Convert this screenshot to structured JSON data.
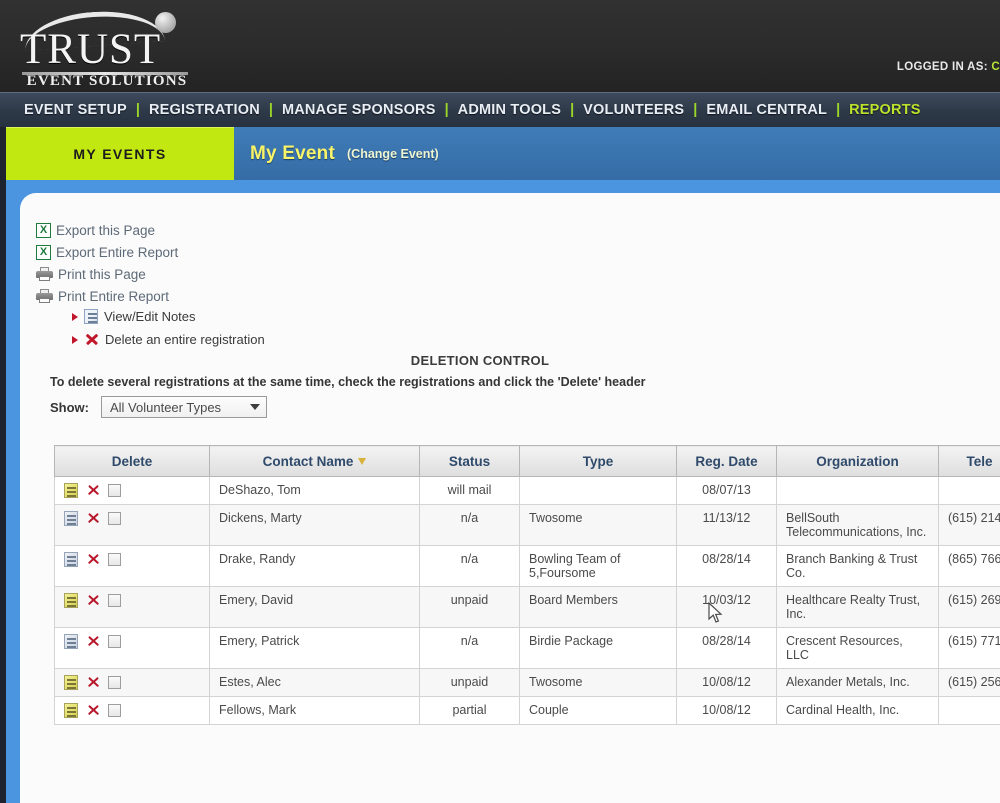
{
  "brand": {
    "name": "TRUST",
    "tagline": "EVENT SOLUTIONS"
  },
  "header": {
    "logged_in_label": "LOGGED IN AS:",
    "logged_in_user": "C"
  },
  "nav": {
    "items": [
      {
        "label": "EVENT SETUP",
        "active": false
      },
      {
        "label": "REGISTRATION",
        "active": false
      },
      {
        "label": "MANAGE SPONSORS",
        "active": false
      },
      {
        "label": "ADMIN TOOLS",
        "active": false
      },
      {
        "label": "VOLUNTEERS",
        "active": false
      },
      {
        "label": "EMAIL CENTRAL",
        "active": false
      },
      {
        "label": "REPORTS",
        "active": true
      }
    ],
    "separator": "|"
  },
  "tabs": {
    "my_events": "MY EVENTS",
    "event_name": "My Event",
    "change_event": "(Change Event)"
  },
  "actions": {
    "export_page": "Export this Page",
    "export_report": "Export Entire Report",
    "print_page": "Print this Page",
    "print_report": "Print Entire Report",
    "view_edit_notes": "View/Edit Notes",
    "delete_registration": "Delete an entire registration"
  },
  "deletion": {
    "title": "DELETION CONTROL",
    "hint": "To delete several registrations at the same time, check the registrations and click the 'Delete' header",
    "show_label": "Show:",
    "show_value": "All Volunteer Types"
  },
  "table": {
    "columns": [
      "Delete",
      "Contact Name",
      "Status",
      "Type",
      "Reg. Date",
      "Organization",
      "Tele"
    ],
    "sorted_column": "Contact Name",
    "rows": [
      {
        "name": "DeShazo, Tom",
        "status": "will mail",
        "type": "",
        "date": "08/07/13",
        "org": "",
        "phone": ""
      },
      {
        "name": "Dickens, Marty",
        "status": "n/a",
        "type": "Twosome",
        "date": "11/13/12",
        "org": "BellSouth Telecommunications, Inc.",
        "phone": "(615) 214"
      },
      {
        "name": "Drake, Randy",
        "status": "n/a",
        "type": "Bowling Team of 5,Foursome",
        "date": "08/28/14",
        "org": "Branch Banking & Trust Co.",
        "phone": "(865) 766"
      },
      {
        "name": "Emery, David",
        "status": "unpaid",
        "type": "Board Members",
        "date": "10/03/12",
        "org": "Healthcare Realty Trust, Inc.",
        "phone": "(615) 269"
      },
      {
        "name": "Emery, Patrick",
        "status": "n/a",
        "type": "Birdie Package",
        "date": "08/28/14",
        "org": "Crescent Resources, LLC",
        "phone": "(615) 771"
      },
      {
        "name": "Estes, Alec",
        "status": "unpaid",
        "type": "Twosome",
        "date": "10/08/12",
        "org": "Alexander Metals, Inc.",
        "phone": "(615) 256"
      },
      {
        "name": "Fellows, Mark",
        "status": "partial",
        "type": "Couple",
        "date": "10/08/12",
        "org": "Cardinal Health, Inc.",
        "phone": ""
      }
    ]
  },
  "colors": {
    "accent_green": "#c2e812",
    "nav_bg": "#2f3a49",
    "tab_blue": "#3b79b5",
    "frame_blue": "#4a94e0",
    "header_text": "#2f4a6b",
    "delete_red": "#b8172b"
  }
}
